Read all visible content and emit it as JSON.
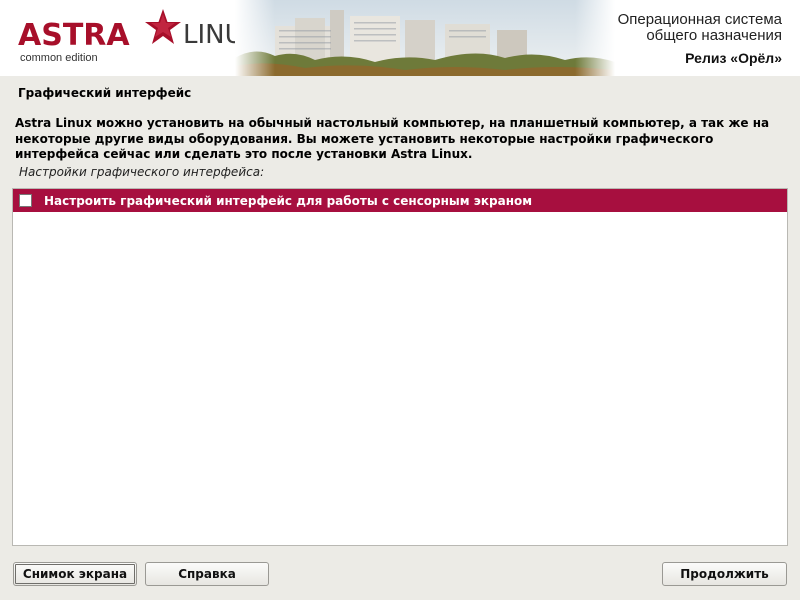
{
  "header": {
    "logo_astra": "ASTRA",
    "logo_linux": "LINUX",
    "logo_edition": "common edition",
    "os_line1": "Операционная система",
    "os_line2": "общего назначения",
    "release": "Релиз «Орёл»"
  },
  "section": {
    "title": "Графический интерфейс",
    "description": "Astra Linux можно установить на обычный настольный компьютер, на планшетный компьютер, а так же на некоторые другие виды оборудования. Вы можете установить некоторые настройки графического интерфейса сейчас или сделать это после установки Astra Linux.",
    "list_caption": "Настройки графического интерфейса:"
  },
  "options": [
    {
      "label": "Настроить графический интерфейс для работы с сенсорным экраном",
      "checked": false,
      "selected": true
    }
  ],
  "buttons": {
    "screenshot": "Снимок экрана",
    "help": "Справка",
    "continue": "Продолжить"
  },
  "colors": {
    "brand": "#a70f2a",
    "selection": "#a70f3f",
    "background": "#ecebe6"
  }
}
